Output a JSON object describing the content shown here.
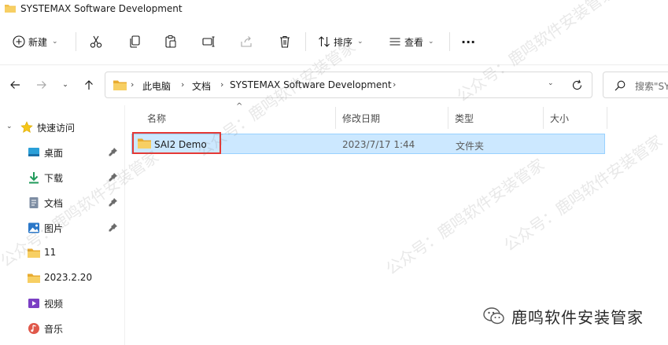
{
  "window": {
    "title": "SYSTEMAX Software Development"
  },
  "toolbar": {
    "new_label": "新建",
    "sort_label": "排序",
    "view_label": "查看",
    "more_label": "···"
  },
  "address": {
    "crumbs": [
      "此电脑",
      "文档",
      "SYSTEMAX Software Development"
    ],
    "search_placeholder": "搜索\"SY"
  },
  "sidebar": {
    "quick_access": "快速访问",
    "items": [
      {
        "label": "桌面",
        "icon": "desktop-icon",
        "pinned": true
      },
      {
        "label": "下载",
        "icon": "download-icon",
        "pinned": true
      },
      {
        "label": "文档",
        "icon": "document-icon",
        "pinned": true
      },
      {
        "label": "图片",
        "icon": "pictures-icon",
        "pinned": true
      },
      {
        "label": "11",
        "icon": "folder-icon",
        "pinned": false
      },
      {
        "label": "2023.2.20",
        "icon": "folder-icon",
        "pinned": false
      },
      {
        "label": "视频",
        "icon": "videos-icon",
        "pinned": false
      },
      {
        "label": "音乐",
        "icon": "music-icon",
        "pinned": false
      }
    ]
  },
  "columns": {
    "name": "名称",
    "modified": "修改日期",
    "type": "类型",
    "size": "大小"
  },
  "files": [
    {
      "name": "SAI2 Demo",
      "modified": "2023/7/17 1:44",
      "type": "文件夹",
      "size": ""
    }
  ],
  "watermark": {
    "text": "公众号：鹿鸣软件安装管家",
    "brand": "鹿鸣软件安装管家"
  },
  "colors": {
    "selection": "#cce8ff",
    "selection_border": "#99d1ff",
    "highlight_box": "#e53935",
    "folder": "#f2c14e"
  }
}
